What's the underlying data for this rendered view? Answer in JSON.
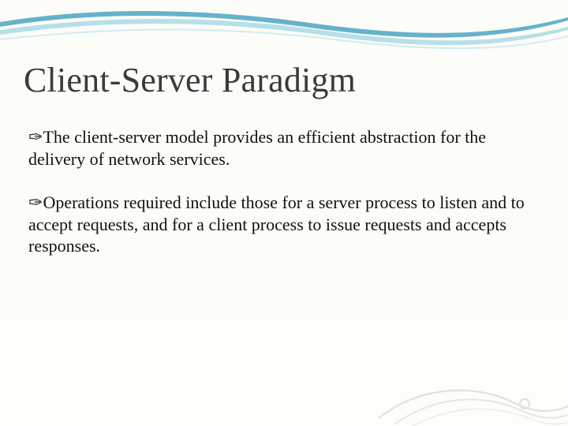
{
  "slide": {
    "title": "Client-Server Paradigm",
    "bullets": [
      {
        "glyph": "✑",
        "text": "The client-server model provides an efficient abstraction for the delivery of network services."
      },
      {
        "glyph": "✑",
        "text": "Operations required include those for a server process to listen and to accept requests, and for a client process to issue requests and accepts responses."
      }
    ]
  }
}
